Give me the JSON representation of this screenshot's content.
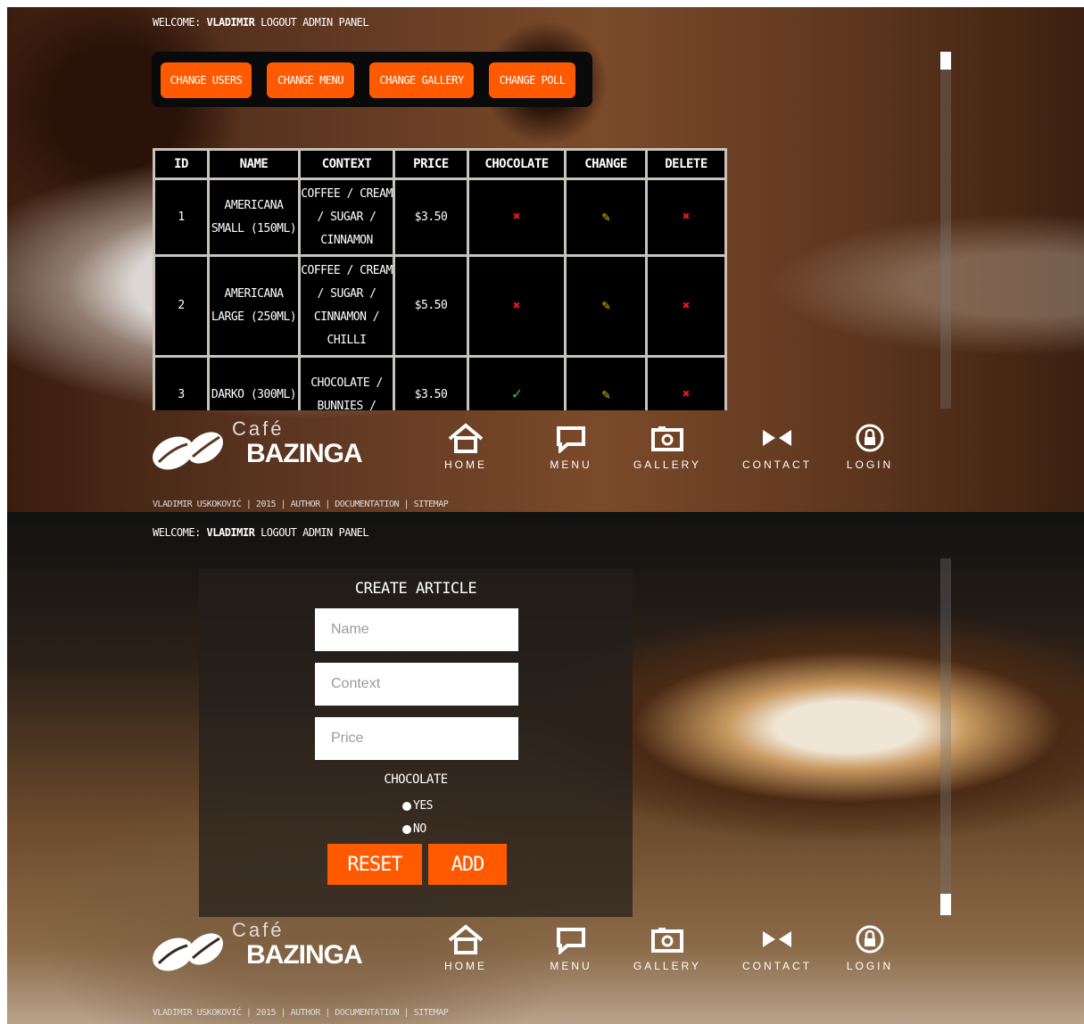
{
  "welcome": {
    "prefix": "WELCOME:",
    "user": "VLADIMIR",
    "logout": "LOGOUT",
    "admin_panel": "ADMIN PANEL"
  },
  "admin_buttons": [
    "CHANGE USERS",
    "CHANGE MENU",
    "CHANGE GALLERY",
    "CHANGE POLL"
  ],
  "table": {
    "headers": [
      "ID",
      "NAME",
      "CONTEXT",
      "PRICE",
      "CHOCOLATE",
      "CHANGE",
      "DELETE"
    ],
    "rows": [
      {
        "id": "1",
        "name": "AMERICANA SMALL (150ML)",
        "context": "COFFEE / CREAM / SUGAR / CINNAMON",
        "price": "$3.50",
        "chocolate": "no"
      },
      {
        "id": "2",
        "name": "AMERICANA LARGE (250ML)",
        "context": "COFFEE / CREAM / SUGAR / CINNAMON / CHILLI",
        "price": "$5.50",
        "chocolate": "no"
      },
      {
        "id": "3",
        "name": "DARKO (300ML)",
        "context": "CHOCOLATE / BUNNIES /",
        "price": "$3.50",
        "chocolate": "yes"
      }
    ]
  },
  "logo": {
    "cafe": "Café",
    "brand": "BAZINGA"
  },
  "nav": [
    {
      "label": "HOME",
      "icon": "home-icon"
    },
    {
      "label": "MENU",
      "icon": "chat-icon"
    },
    {
      "label": "GALLERY",
      "icon": "camera-icon"
    },
    {
      "label": "CONTACT",
      "icon": "bowtie-icon"
    },
    {
      "label": "LOGIN",
      "icon": "lock-icon"
    }
  ],
  "footer": "VLADIMIR USKOKOVIĆ | 2015 | AUTHOR | DOCUMENTATION | SITEMAP",
  "create": {
    "title": "CREATE ARTICLE",
    "name_placeholder": "Name",
    "context_placeholder": "Context",
    "price_placeholder": "Price",
    "chocolate_label": "CHOCOLATE",
    "yes": "YES",
    "no": "NO",
    "reset": "RESET",
    "add": "ADD"
  },
  "colors": {
    "accent": "#ff5a00",
    "delete": "#e31b1b",
    "check": "#3fbf3f",
    "edit": "#f3c300"
  }
}
